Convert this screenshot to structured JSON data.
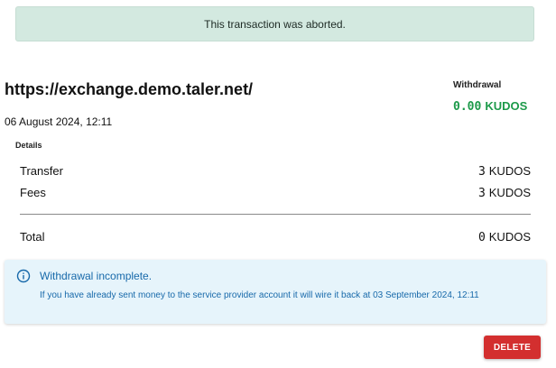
{
  "banner": {
    "text": "This transaction was aborted."
  },
  "header": {
    "title": "https://exchange.demo.taler.net/",
    "date": "06 August 2024, 12:11"
  },
  "amount": {
    "label": "Withdrawal",
    "value": "0.00",
    "currency": "KUDOS",
    "color": "#1d9a4a"
  },
  "details": {
    "label": "Details",
    "rows": [
      {
        "label": "Transfer",
        "value": "3",
        "currency": "KUDOS"
      },
      {
        "label": "Fees",
        "value": "3",
        "currency": "KUDOS"
      }
    ],
    "total": {
      "label": "Total",
      "value": "0",
      "currency": "KUDOS"
    }
  },
  "info": {
    "icon": "info-icon",
    "title": "Withdrawal incomplete.",
    "text": "If you have already sent money to the service provider account it will wire it back at 03 September 2024, 12:11"
  },
  "actions": {
    "delete_label": "DELETE",
    "delete_color": "#d32f2f"
  }
}
